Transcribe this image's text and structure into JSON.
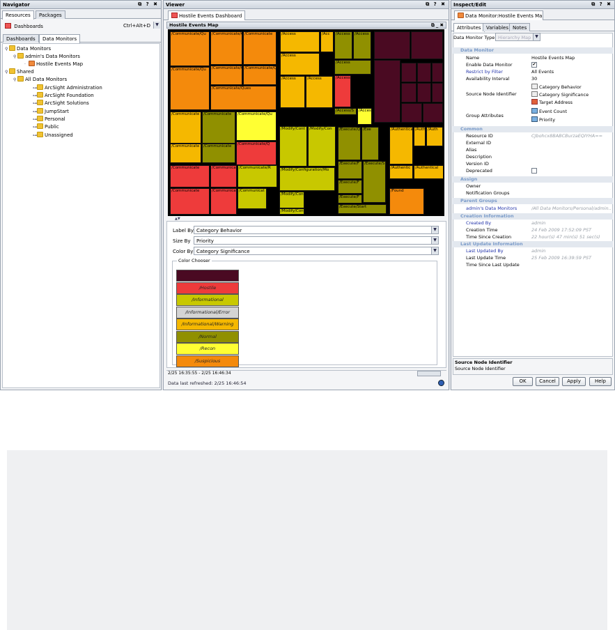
{
  "navigator": {
    "title": "Navigator",
    "controls": "⧉ ? ✖",
    "tabs": [
      "Resources",
      "Packages"
    ],
    "resource_type": "Dashboards",
    "shortcut": "Ctrl+Alt+D",
    "subtabs": [
      "Dashboards",
      "Data Monitors"
    ],
    "tree": [
      {
        "label": "Data Monitors"
      },
      {
        "label": "admin's Data Monitors"
      },
      {
        "label": "Hostile Events Map"
      },
      {
        "label": "Shared"
      },
      {
        "label": "All Data Monitors"
      },
      {
        "label": "ArcSight Administration"
      },
      {
        "label": "ArcSight Foundation"
      },
      {
        "label": "ArcSight Solutions"
      },
      {
        "label": "JumpStart"
      },
      {
        "label": "Personal"
      },
      {
        "label": "Public"
      },
      {
        "label": "Unassigned"
      }
    ]
  },
  "viewer": {
    "title": "Viewer",
    "controls": "⧉ ? ✖",
    "tab": "Hostile Events Dashboard",
    "map_title": "Hostile Events Map",
    "map_controls": "⧉ _ ✖",
    "label_by_label": "Label By",
    "label_by_value": "Category Behavior",
    "size_by_label": "Size By",
    "size_by_value": "Priority",
    "color_by_label": "Color By",
    "color_by_value": "Category Significance",
    "color_chooser_title": "Color Chooser",
    "swatches": [
      {
        "label": "",
        "color": "#4a0a22"
      },
      {
        "label": "/Hostile",
        "color": "#ee3b3b"
      },
      {
        "label": "/Informational",
        "color": "#c8c800"
      },
      {
        "label": "/Informational/Error",
        "color": "#d4d4d4"
      },
      {
        "label": "/Informational/Warning",
        "color": "#f5b800"
      },
      {
        "label": "/Normal",
        "color": "#909000"
      },
      {
        "label": "/Recon",
        "color": "#ffff33"
      },
      {
        "label": "/Suspicious",
        "color": "#f48a0c"
      }
    ],
    "time_range": "2/25 16:35:55 - 2/25 16:46:34",
    "refresh_status": "Data last refreshed: 2/25 16:46:54"
  },
  "inspect": {
    "title": "Inspect/Edit",
    "controls": "⧉ ? ✖",
    "tab": "Data Monitor:Hostile Events Ma...",
    "subtabs": [
      "Attributes",
      "Variables",
      "Notes"
    ],
    "type_label": "Data Monitor Type",
    "type_value": "Hierarchy Map",
    "sections": {
      "data_monitor": "Data Monitor",
      "common": "Common",
      "assign": "Assign",
      "parent_groups": "Parent Groups",
      "creation": "Creation Information",
      "last_update": "Last Update Information"
    },
    "fields": {
      "name_label": "Name",
      "name_value": "Hostile Events Map",
      "enable_label": "Enable Data Monitor",
      "restrict_label": "Restrict by Filter",
      "restrict_value": "All Events",
      "avail_label": "Availability Interval",
      "avail_value": "30",
      "source_label": "Source Node Identifier",
      "source_values": [
        "Category Behavior",
        "Category Significance",
        "Target Address"
      ],
      "group_label": "Group Attributes",
      "group_values": [
        "Event Count",
        "Priority"
      ],
      "resource_id_label": "Resource ID",
      "resource_id_value": "CJbohcx8BABCBurzaEQIYHA==",
      "external_id_label": "External ID",
      "alias_label": "Alias",
      "description_label": "Description",
      "version_label": "Version ID",
      "deprecated_label": "Deprecated",
      "owner_label": "Owner",
      "notification_label": "Notification Groups",
      "parent_label": "admin's Data Monitors",
      "parent_value": "/All Data Monitors/Personal/admin...",
      "created_by_label": "Created By",
      "created_by_value": "admin",
      "creation_time_label": "Creation Time",
      "creation_time_value": "24 Feb 2009 17:52:09 PST",
      "since_creation_label": "Time Since Creation",
      "since_creation_value": "22 hour(s) 47 min(s) 51 sec(s)",
      "updated_by_label": "Last Updated By",
      "updated_by_value": "admin",
      "update_time_label": "Last Update Time",
      "update_time_value": "25 Feb 2009 16:39:59 PST",
      "since_update_label": "Time Since Last Update"
    },
    "help_title": "Source Node Identifier",
    "help_text": "Source Node Identifier",
    "buttons": [
      "OK",
      "Cancel",
      "Apply",
      "Help"
    ]
  },
  "treemap": [
    {
      "t": "/Communicate/Qu",
      "c": "#f48a0c"
    },
    {
      "t": "/Communicate/Qu",
      "c": "#f48a0c"
    },
    {
      "t": "/Communicate",
      "c": "#f48a0c"
    },
    {
      "t": "/Communicate/Ques",
      "c": "#f48a0c"
    },
    {
      "t": "/Communicate/Ques",
      "c": "#f48a0c"
    },
    {
      "t": "/Communicate/Qu",
      "c": "#f48a0c"
    },
    {
      "t": "/Communicate/Ques",
      "c": "#f48a0c"
    },
    {
      "t": "/Access",
      "c": "#f5b800"
    },
    {
      "t": "/Acc",
      "c": "#f5b800"
    },
    {
      "t": "/Access",
      "c": "#f5b800"
    },
    {
      "t": "/Access",
      "c": "#f5b800"
    },
    {
      "t": "/Access",
      "c": "#f5b800"
    },
    {
      "t": "/Access",
      "c": "#ee3b3b"
    },
    {
      "t": "/Access",
      "c": "#909000"
    },
    {
      "t": "/Access",
      "c": "#909000"
    },
    {
      "t": "/Access",
      "c": "#909000"
    },
    {
      "t": "/Access/S",
      "c": "#909000"
    },
    {
      "t": "/Acces",
      "c": "#ffff33"
    },
    {
      "t": "/Communicate",
      "c": "#f5b800"
    },
    {
      "t": "/Communicate",
      "c": "#909000"
    },
    {
      "t": "/Communicate/Qu",
      "c": "#ffff33"
    },
    {
      "t": "/Communicate",
      "c": "#f5b800"
    },
    {
      "t": "/Communicate",
      "c": "#909000"
    },
    {
      "t": "/Communicate/Q",
      "c": "#ee3b3b"
    },
    {
      "t": "/Modify/Cont",
      "c": "#c8c800"
    },
    {
      "t": "/Modify/Con",
      "c": "#c8c800"
    },
    {
      "t": "/Execute/Que",
      "c": "#909000"
    },
    {
      "t": "/Exe",
      "c": "#909000"
    },
    {
      "t": "/Authenticat",
      "c": "#f5b800"
    },
    {
      "t": "/Auth",
      "c": "#f5b800"
    },
    {
      "t": "/Auth",
      "c": "#f5b800"
    },
    {
      "t": "/Communicate",
      "c": "#ee3b3b"
    },
    {
      "t": "/Communicate",
      "c": "#ee3b3b"
    },
    {
      "t": "/Communicate/R",
      "c": "#c8c800"
    },
    {
      "t": "/Communicate",
      "c": "#ee3b3b"
    },
    {
      "t": "/Communicate",
      "c": "#ee3b3b"
    },
    {
      "t": "/Communicat",
      "c": "#c8c800"
    },
    {
      "t": "/Modify/Configuration/Mo",
      "c": "#c8c800"
    },
    {
      "t": "/Modify/Configurat",
      "c": "#c8c800"
    },
    {
      "t": "/Modify/Content",
      "c": "#c8c800"
    },
    {
      "t": "/Execute/F",
      "c": "#909000"
    },
    {
      "t": "/Execute/S",
      "c": "#909000"
    },
    {
      "t": "/Execute/F",
      "c": "#909000"
    },
    {
      "t": "/Execute/F",
      "c": "#909000"
    },
    {
      "t": "/Execute/Start",
      "c": "#909000"
    },
    {
      "t": "/Authentic",
      "c": "#f5b800"
    },
    {
      "t": "/Authentical",
      "c": "#f5b800"
    },
    {
      "t": "/Found",
      "c": "#f48a0c"
    }
  ]
}
